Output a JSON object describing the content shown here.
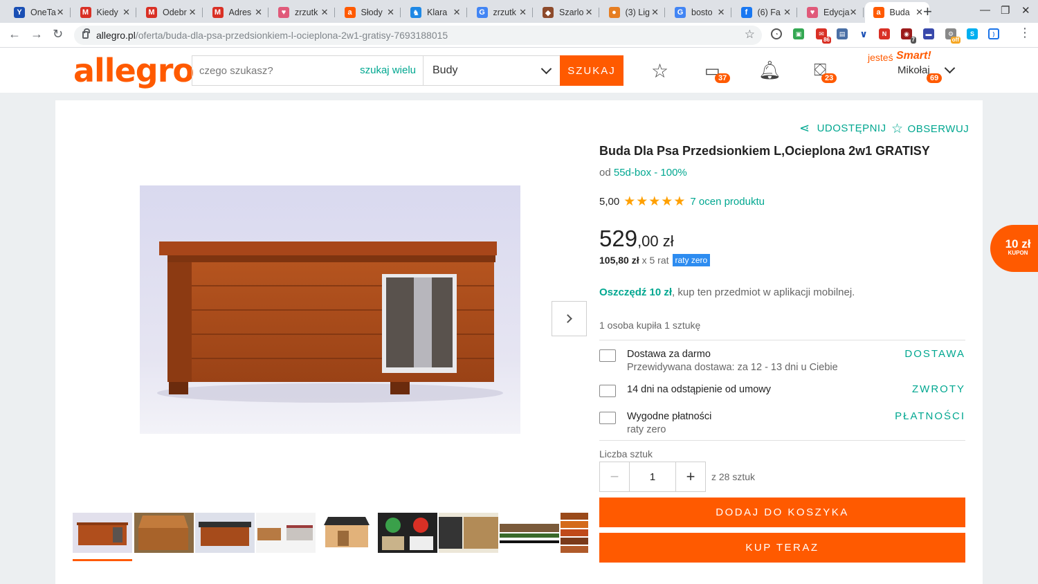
{
  "browser": {
    "tabs": [
      {
        "title": "OneTa",
        "icon": "yandex-icon",
        "color": "#1a4fb4",
        "glyph": "Y"
      },
      {
        "title": "Kiedy",
        "icon": "gmail-icon",
        "color": "#d93025",
        "glyph": "M"
      },
      {
        "title": "Odebr",
        "icon": "gmail-icon",
        "color": "#d93025",
        "glyph": "M"
      },
      {
        "title": "Adres",
        "icon": "gmail-icon",
        "color": "#d93025",
        "glyph": "M"
      },
      {
        "title": "zrzutk",
        "icon": "zrzutka-icon",
        "color": "#e05a7a",
        "glyph": "♥"
      },
      {
        "title": "Słody",
        "icon": "allegro-icon",
        "color": "#ff5a00",
        "glyph": "a"
      },
      {
        "title": "Klara",
        "icon": "clothes-icon",
        "color": "#1e88e5",
        "glyph": "♞"
      },
      {
        "title": "zrzutk",
        "icon": "google-icon",
        "color": "#4285f4",
        "glyph": "G"
      },
      {
        "title": "Szarlo",
        "icon": "cake-icon",
        "color": "#8d4a2b",
        "glyph": "◆"
      },
      {
        "title": "(3) Lig",
        "icon": "basketball-icon",
        "color": "#e67e22",
        "glyph": "●"
      },
      {
        "title": "bosto",
        "icon": "google-icon",
        "color": "#4285f4",
        "glyph": "G"
      },
      {
        "title": "(6) Fa",
        "icon": "facebook-icon",
        "color": "#1877f2",
        "glyph": "f"
      },
      {
        "title": "Edycja",
        "icon": "zrzutka-icon",
        "color": "#e05a7a",
        "glyph": "♥"
      },
      {
        "title": "Buda",
        "icon": "allegro-icon",
        "color": "#ff5a00",
        "glyph": "a",
        "active": true
      }
    ],
    "url_host": "allegro.pl",
    "url_path": "/oferta/buda-dla-psa-przedsionkiem-l-ocieplona-2w1-gratisy-7693188015",
    "ext_badges": [
      "86",
      "7",
      "off"
    ]
  },
  "header": {
    "logo": "allegro",
    "search_placeholder": "czego szukasz?",
    "search_multi": "szukaj wielu",
    "category": "Budy",
    "search_button": "SZUKAJ",
    "messages_count": "37",
    "cart_count": "23",
    "smart_prefix": "jesteś",
    "smart_label": "Smart!",
    "user_name": "Mikołaj",
    "user_badge": "69"
  },
  "product": {
    "share": "UDOSTĘPNIJ",
    "watch": "OBSERWUJ",
    "title": "Buda Dla Psa Przedsionkiem L,Ocieplona 2w1 GRATISY",
    "seller_prefix": "od",
    "seller": "55d-box - 100%",
    "rating_value": "5,00",
    "stars": "★★★★★",
    "rating_link": "7 ocen produktu",
    "price_main": "529",
    "price_cents": ",00 zł",
    "installment_amount": "105,80 zł",
    "installment_count": "x 5 rat",
    "installment_badge": "raty zero",
    "save_bold": "Oszczędź 10 zł",
    "save_rest": ", kup ten przedmiot w aplikacji mobilnej.",
    "bought": "1 osoba kupiła 1 sztukę",
    "delivery_title": "Dostawa za darmo",
    "delivery_sub": "Przewidywana dostawa: za 12 - 13 dni u Ciebie",
    "delivery_link": "DOSTAWA",
    "returns_title": "14 dni na odstąpienie od umowy",
    "returns_link": "ZWROTY",
    "payments_title": "Wygodne płatności",
    "payments_sub": "raty zero",
    "payments_link": "PŁATNOŚCI",
    "qty_label": "Liczba sztuk",
    "qty_value": "1",
    "qty_max": "z 28 sztuk",
    "add_to_cart": "DODAJ DO KOSZYKA",
    "buy_now": "KUP TERAZ"
  },
  "coupon": {
    "amount": "10 zł",
    "label": "KUPON"
  },
  "colors": {
    "brand": "#ff5a00",
    "link": "#00a790",
    "star": "#ffa000"
  }
}
